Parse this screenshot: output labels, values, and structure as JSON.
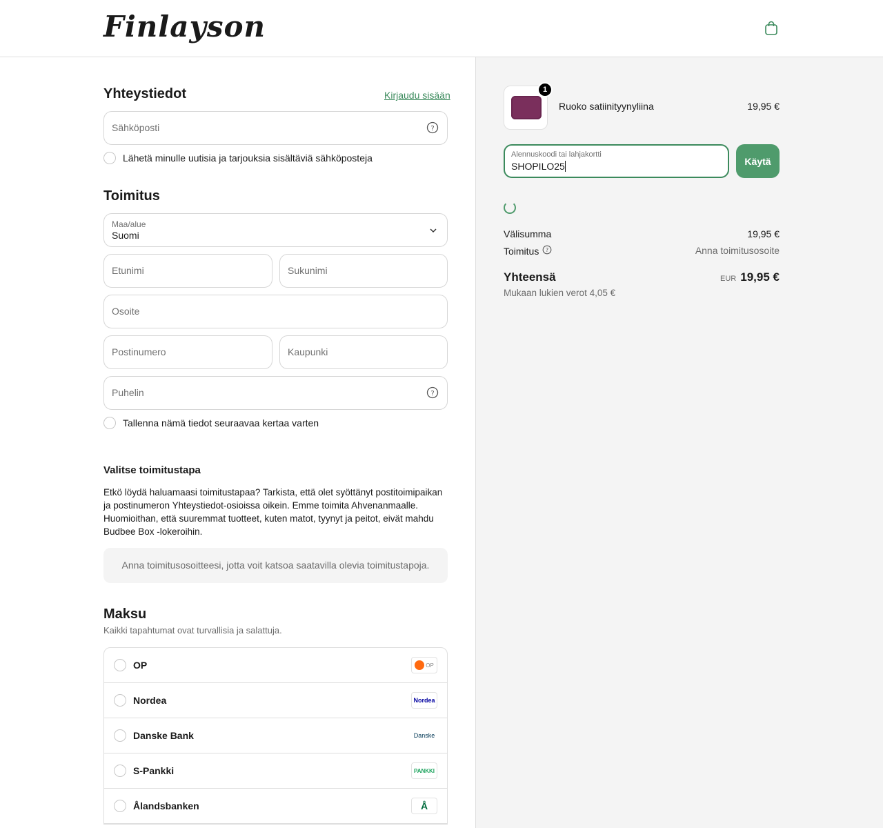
{
  "header": {
    "logo": "Finlayson",
    "cart_icon": "shopping-bag-icon"
  },
  "contact": {
    "title": "Yhteystiedot",
    "login_link": "Kirjaudu sisään",
    "email_placeholder": "Sähköposti",
    "newsletter_label": "Lähetä minulle uutisia ja tarjouksia sisältäviä sähköposteja"
  },
  "delivery": {
    "title": "Toimitus",
    "country_label": "Maa/alue",
    "country_value": "Suomi",
    "first_name": "Etunimi",
    "last_name": "Sukunimi",
    "address": "Osoite",
    "postal_code": "Postinumero",
    "city": "Kaupunki",
    "phone": "Puhelin",
    "save_label": "Tallenna nämä tiedot seuraavaa kertaa varten"
  },
  "shipping_method": {
    "title": "Valitse toimitustapa",
    "info": "Etkö löydä haluamaasi toimitustapaa? Tarkista, että olet syöttänyt postitoimipaikan ja postinumeron Yhteystiedot-osioissa oikein. Emme toimita Ahvenanmaalle. Huomioithan, että suuremmat tuotteet, kuten matot, tyynyt ja peitot, eivät mahdu Budbee Box -lokeroihin.",
    "notice": "Anna toimitusosoitteesi, jotta voit katsoa saatavilla olevia toimitustapoja."
  },
  "payment": {
    "title": "Maksu",
    "subtitle": "Kaikki tapahtumat ovat turvallisia ja salattuja.",
    "methods": [
      {
        "name": "OP",
        "badge": "OP"
      },
      {
        "name": "Nordea",
        "badge": "Nordea"
      },
      {
        "name": "Danske Bank",
        "badge": "Danske"
      },
      {
        "name": "S-Pankki",
        "badge": "PANKKI"
      },
      {
        "name": "Ålandsbanken",
        "badge": "Å"
      }
    ]
  },
  "summary": {
    "item": {
      "name": "Ruoko satiinityynyliina",
      "price": "19,95 €",
      "quantity": "1"
    },
    "discount_label": "Alennuskoodi tai lahjakortti",
    "discount_value": "SHOPILO25",
    "apply_label": "Käytä",
    "subtotal_label": "Välisumma",
    "subtotal_value": "19,95 €",
    "shipping_label": "Toimitus",
    "shipping_value": "Anna toimitusosoite",
    "total_label": "Yhteensä",
    "currency": "EUR",
    "total_value": "19,95 €",
    "tax_note": "Mukaan lukien verot 4,05 €"
  },
  "colors": {
    "accent": "#4f9b6c",
    "link": "#3b8a5c",
    "panel": "#f4f4f4"
  }
}
